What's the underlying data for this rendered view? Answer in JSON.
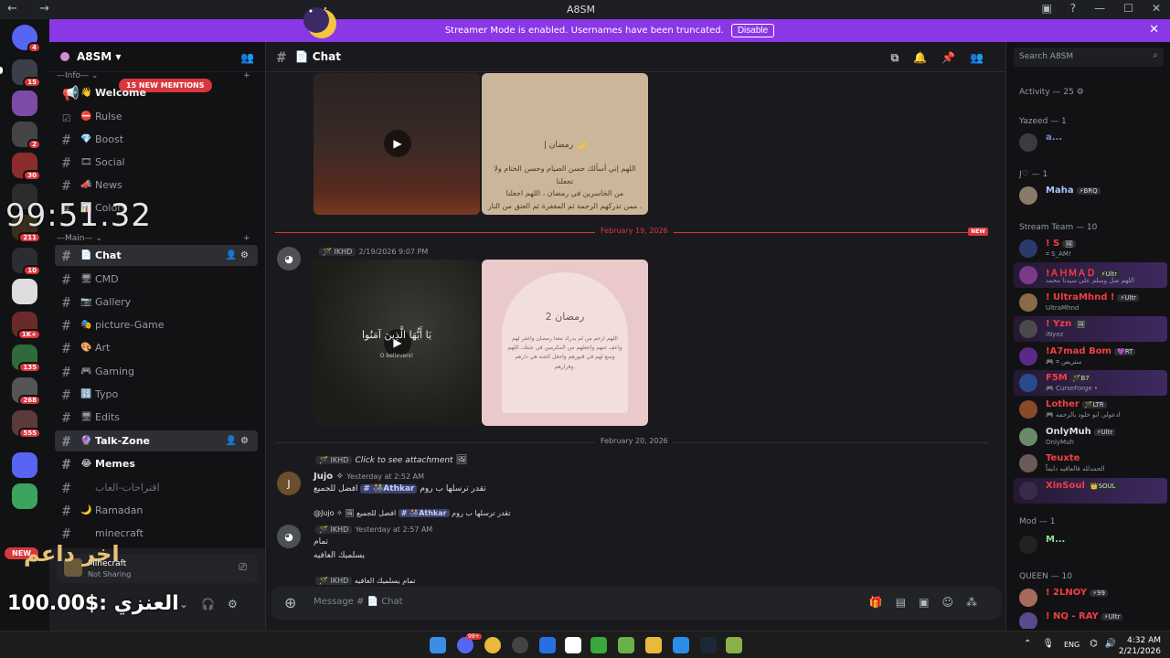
{
  "window": {
    "title": "A8SM",
    "nav": "← →",
    "controls": [
      "▣",
      "?",
      "—",
      "☐",
      "✕"
    ]
  },
  "banner": {
    "text": "Streamer Mode is enabled. Usernames have been truncated.",
    "disable_label": "Disable"
  },
  "rail": {
    "badges": [
      "4",
      "15",
      "2",
      "30",
      "211",
      "10",
      "1K+",
      "135",
      "268",
      "555"
    ],
    "new_label": "NEW"
  },
  "server": {
    "name": "A8SM ▾",
    "mentions_label": "15 NEW MENTIONS"
  },
  "categories": {
    "info": "—Info— ⌄",
    "main": "—Main— ⌄"
  },
  "channels": [
    {
      "emoji": "👋",
      "name": "Welcome"
    },
    {
      "emoji": "⛔",
      "name": "Rulse"
    },
    {
      "emoji": "💎",
      "name": "Boost"
    },
    {
      "emoji": "🎞",
      "name": "Social"
    },
    {
      "emoji": "📣",
      "name": "News"
    },
    {
      "emoji": "📊",
      "name": "Colors"
    },
    {
      "emoji": "📄",
      "name": "Chat"
    },
    {
      "emoji": "🖥",
      "name": "CMD"
    },
    {
      "emoji": "📷",
      "name": "Gallery"
    },
    {
      "emoji": "🎭",
      "name": "picture-Game"
    },
    {
      "emoji": "🎨",
      "name": "Art"
    },
    {
      "emoji": "🎮",
      "name": "Gaming"
    },
    {
      "emoji": "🔢",
      "name": "Typo"
    },
    {
      "emoji": "🖥",
      "name": "Edits"
    },
    {
      "emoji": "🔮",
      "name": "Talk-Zone"
    },
    {
      "emoji": "😂",
      "name": "Memes"
    },
    {
      "emoji": "",
      "name": "اقتراحات-الغاب"
    },
    {
      "emoji": "🌙",
      "name": "Ramadan"
    },
    {
      "emoji": "",
      "name": "minecraft"
    }
  ],
  "overlay": {
    "timer": "99:51.32",
    "arabic_top": "اخر داعم",
    "money": "العنزي :$100.00"
  },
  "user_panel": {
    "stream_title": "Minecraft",
    "stream_sub": "Not Sharing"
  },
  "chat": {
    "channel": "📄 Chat",
    "image_text_1_title": "| رمضان 🌙",
    "image_text_1_body": "اللهم إني أسألك حسن الصيام وحسن الختام ولا تجعلنا\nمن الخاسرين في رمضان ، اللهم اجعلنا\nممن تدركهم الرحمة ثم المغفرة ثم العتق من النار .",
    "divider_1": "February 19, 2026",
    "new_tag": "NEW",
    "msg1": {
      "tag": "🪄 IKHD",
      "time": "2/19/2026 9:07 PM"
    },
    "image_text_2_title": "2 رمضان",
    "image_text_2_body": "اللهم ارحم من لم يدرك معنا رمضان واغفر لهم\nواعف عنهم واجعلهم من المكرمين في جنتك، اللهم\nوسع لهم في قبورهم واجعل الجنة هي دارهم\nوقرارهم.",
    "video_caption": "يَا أَيُّهَا الَّذِينَ آمَنُوا",
    "video_caption_en": "O believers!",
    "divider_2": "February 20, 2026",
    "reply1": {
      "tag": "🪄 IKHD",
      "text": "Click to see attachment"
    },
    "msg2": {
      "author": "Jujo ✧",
      "time": "Yesterday at 2:52 AM",
      "line_a": "تقدر ترسلها ب روم",
      "line_b": "افضل للجميع",
      "mention": "👫Athkar"
    },
    "reply2": {
      "text": "@Jujo ✧ 🖼 افضل للجميع",
      "mention": "👫Athkar",
      "tail": "تقدر ترسلها ب روم"
    },
    "msg3": {
      "tag": "🪄 IKHD",
      "time": "Yesterday at 2:57 AM",
      "line_a": "تمام",
      "line_b": "يسلميك العافيه"
    },
    "reply3": {
      "tag": "🪄 IKHD",
      "text": "تمام يسلميك العافيه"
    },
    "composer_placeholder": "Message # 📄 Chat"
  },
  "members": {
    "search_placeholder": "Search A8SM",
    "activity": "Activity — 25 ⚙",
    "groups": [
      {
        "label": "Yazeed — 1",
        "members": [
          {
            "name": "a...",
            "sub": "",
            "color": "#7289da",
            "tag": ""
          }
        ]
      },
      {
        "label": "J♡ — 1",
        "members": [
          {
            "name": "Maha",
            "sub": "",
            "color": "#a9c3ff",
            "tag": "⚡BRQ"
          }
        ]
      },
      {
        "label": "Stream Team — 10",
        "members": [
          {
            "name": "! S",
            "sub": "⌗ S_AM!",
            "color": "#f23f43",
            "tag": "🖼"
          },
          {
            "name": "!ＡＨＭＡＤ",
            "sub": "اللهم صل وسلم على سيدنا محمد",
            "color": "#f23f43",
            "tag": "⚡Ultr"
          },
          {
            "name": "! UltraMhnd !",
            "sub": "UltraMhnd",
            "color": "#f23f43",
            "tag": "⚡Ultr"
          },
          {
            "name": "! Yzn",
            "sub": "iNyez",
            "color": "#f23f43",
            "tag": "🖼"
          },
          {
            "name": "!A7mad Bom",
            "sub": "🎮 ⌗ ستریص",
            "color": "#f23f43",
            "tag": "💜RT"
          },
          {
            "name": "F5M",
            "sub": "🎮 CurseForge •",
            "color": "#f23f43",
            "tag": "🪄B7"
          },
          {
            "name": "Lother",
            "sub": "🎮 ادعولي ابو خلود بالرحمه",
            "color": "#f23f43",
            "tag": "🪄LTR"
          },
          {
            "name": "OnlyMuh",
            "sub": "OnlyMuh",
            "color": "#dbdee1",
            "tag": "⚡Ultr"
          },
          {
            "name": "Teuxte",
            "sub": "الحمدلله فالعافيه دايماً",
            "color": "#f23f43",
            "tag": ""
          },
          {
            "name": "XinSoul",
            "sub": "",
            "color": "#f23f43",
            "tag": "👑SOUL"
          }
        ]
      },
      {
        "label": "Mod — 1",
        "members": [
          {
            "name": "M...",
            "sub": "",
            "color": "#5865f2",
            "tag": ""
          }
        ]
      },
      {
        "label": "QUEEN — 10",
        "members": [
          {
            "name": "! 2LNOY",
            "sub": "",
            "color": "#f23f43",
            "tag": "⚡99"
          },
          {
            "name": "! NQ - RAY",
            "sub": "",
            "color": "#f23f43",
            "tag": "⚡Ultr"
          }
        ]
      }
    ]
  },
  "taskbar": {
    "lang": "ENG",
    "time": "4:32 AM",
    "date": "2/21/2026",
    "badge": "99+"
  }
}
